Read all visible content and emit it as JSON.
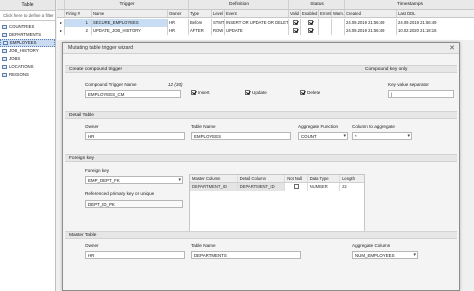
{
  "left_panel": {
    "header": "Table",
    "filter_placeholder": "Click here to define a filter",
    "items": [
      {
        "label": "COUNTRIES"
      },
      {
        "label": "DEPARTMENTS"
      },
      {
        "label": "EMPLOYEES"
      },
      {
        "label": "JOB_HISTORY"
      },
      {
        "label": "JOBS"
      },
      {
        "label": "LOCATIONS"
      },
      {
        "label": "REGIONS"
      }
    ]
  },
  "grid": {
    "groups": {
      "trigger": "Trigger",
      "definition": "Definition",
      "status": "Status",
      "timestamps": "Timestamps"
    },
    "columns": {
      "firing": "Firing #",
      "name": "Name",
      "owner": "Owner",
      "type": "Type",
      "level": "Level",
      "event": "Event",
      "valid": "Valid",
      "enabled": "Enabled",
      "errors": "Errors",
      "warn": "Warn.",
      "created": "Created",
      "last_ddl": "Last DDL"
    },
    "rows": [
      {
        "firing": "1",
        "name": "SECURE_EMPLOYEES",
        "owner": "HR",
        "type": "Before",
        "level": "STMT",
        "event": "INSERT OR UPDATE OR DELETE",
        "valid": true,
        "enabled": true,
        "created": "24.09.2019 21:56:49",
        "last_ddl": "24.09.2019 21:56:49"
      },
      {
        "firing": "2",
        "name": "UPDATE_JOB_HISTORY",
        "owner": "HR",
        "type": "AFTER",
        "level": "ROW",
        "event": "UPDATE",
        "valid": true,
        "enabled": true,
        "created": "24.09.2019 21:56:49",
        "last_ddl": "10.02.2020 21:18:16"
      }
    ]
  },
  "dialog": {
    "title": "Mutating table trigger wizard",
    "close_glyph": "✕",
    "create_section": "Create compound trigger",
    "compound_key_section": "Compound key only",
    "trigger_name_label": "Compound Trigger Name",
    "trigger_name_counter": "12 (30)",
    "trigger_name_value": "EMPLOYEES_CM",
    "insert_label": "Insert",
    "insert_checked": true,
    "update_label": "Update",
    "update_checked": true,
    "delete_label": "Delete",
    "delete_checked": true,
    "key_separator_label": "Key value separator",
    "key_separator_value": "|",
    "detail_section": "Detail Table",
    "detail_owner_label": "Owner",
    "detail_owner_value": "HR",
    "detail_table_label": "Table Name",
    "detail_table_value": "EMPLOYEES",
    "aggregate_function_label": "Aggregate Function",
    "aggregate_function_value": "COUNT",
    "column_to_aggregate_label": "Column to aggregate",
    "column_to_aggregate_value": "*",
    "foreign_key_section": "Foreign key",
    "foreign_key_label": "Foreign key",
    "foreign_key_value": "EMP_DEPT_FK",
    "referenced_pk_label": "Referenced primary key or unique",
    "referenced_pk_value": "DEPT_ID_PK",
    "fk_table": {
      "headers": {
        "master_column": "Master Column",
        "detail_column": "Detail Column",
        "not_null": "Not Null",
        "data_type": "Data Type",
        "length": "Length"
      },
      "rows": [
        {
          "master_column": "DEPARTMENT_ID",
          "detail_column": "DEPARTMENT_ID",
          "not_null": false,
          "data_type": "NUMBER",
          "length": "22"
        }
      ]
    },
    "master_section": "Master Table",
    "master_owner_label": "Owner",
    "master_owner_value": "HR",
    "master_table_label": "Table Name",
    "master_table_value": "DEPARTMENTS",
    "aggregate_column_label": "Aggregate Column",
    "aggregate_column_value": "NUM_EMPLOYEES"
  }
}
